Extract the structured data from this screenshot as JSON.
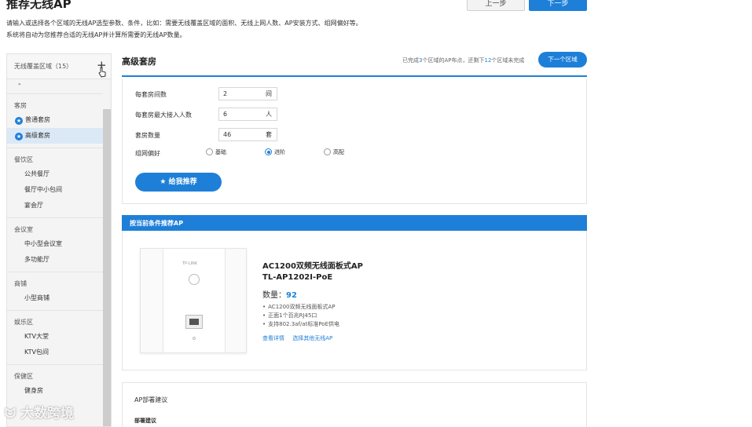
{
  "header": {
    "title": "推荐无线AP",
    "intro_line1": "请输入或选择各个区域的无线AP选型参数、条件，比如：需要无线覆盖区域的面积、无线上网人数、AP安装方式、组网偏好等。",
    "intro_line2": "系统将自动为您推荐合适的无线AP并计算所需要的无线AP数量。",
    "prev_label": "上一步",
    "next_label": "下一步"
  },
  "sidebar": {
    "head_label": "无线覆盖区域（15）",
    "plus": "+",
    "dash": "-",
    "groups": [
      {
        "title": "客房",
        "items": [
          {
            "label": "普通套房",
            "star": true
          },
          {
            "label": "高级套房",
            "star": true,
            "active": true
          }
        ]
      },
      {
        "title": "餐饮区",
        "items": [
          {
            "label": "公共餐厅"
          },
          {
            "label": "餐厅中小包间"
          },
          {
            "label": "宴会厅"
          }
        ]
      },
      {
        "title": "会议室",
        "items": [
          {
            "label": "中小型会议室"
          },
          {
            "label": "多功能厅"
          }
        ]
      },
      {
        "title": "商铺",
        "items": [
          {
            "label": "小型商铺"
          }
        ]
      },
      {
        "title": "娱乐区",
        "items": [
          {
            "label": "KTV大堂"
          },
          {
            "label": "KTV包间"
          }
        ]
      },
      {
        "title": "保健区",
        "items": [
          {
            "label": "健身房"
          }
        ]
      }
    ]
  },
  "main": {
    "title": "高级套房",
    "progress_prefix": "已完成",
    "progress_done": "3",
    "progress_mid": "个区域的AP布点，还剩下",
    "progress_left": "12",
    "progress_suffix": "个区域未完成",
    "next_area_label": "下一个区域"
  },
  "form": {
    "rooms_label": "每套房间数",
    "rooms_value": "2",
    "rooms_unit": "间",
    "users_label": "每套房最大接入人数",
    "users_value": "6",
    "users_unit": "人",
    "suites_label": "套房数量",
    "suites_value": "46",
    "suites_unit": "套",
    "pref_label": "组网偏好",
    "pref_options": [
      "基础",
      "进阶",
      "高配"
    ],
    "pref_selected": "进阶",
    "recommend_label": "给我推荐"
  },
  "result": {
    "header": "按当前条件推荐AP",
    "product_name": "AC1200双频无线面板式AP",
    "model": "TL-AP1202I-PoE",
    "qty_label": "数量：",
    "qty_value": "92",
    "plate_logo": "TP-LINK",
    "features": [
      "AC1200双频无线面板式AP",
      "正面1个百兆RJ45口",
      "支持802.3af/at标准PoE供电"
    ],
    "link_details": "查看详情",
    "link_other": "选择其他无线AP"
  },
  "deploy": {
    "title": "AP部署建议",
    "sub": "部署建议"
  },
  "watermark": "大数跨境",
  "colors": {
    "accent": "#1e7fd8",
    "active_bg": "#dbe9f7"
  }
}
